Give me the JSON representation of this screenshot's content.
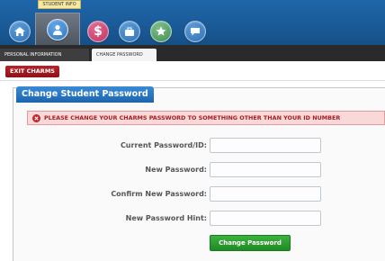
{
  "nav": {
    "tooltip": "STUDENT INFO",
    "icons": [
      {
        "name": "home-icon",
        "color": "#3a84cc"
      },
      {
        "name": "student-info-icon",
        "color": "#2f74bd"
      },
      {
        "name": "billing-icon",
        "color": "#c2456f"
      },
      {
        "name": "briefcase-icon",
        "color": "#3a84cc"
      },
      {
        "name": "star-icon",
        "color": "#5aa36a"
      },
      {
        "name": "chat-icon",
        "color": "#3a84cc"
      }
    ]
  },
  "tabs": {
    "personal": "PERSONAL INFORMATION",
    "change_password": "CHANGE PASSWORD"
  },
  "exit_label": "EXIT CHARMS",
  "panel": {
    "title": "Change Student Password",
    "alert": "PLEASE CHANGE YOUR CHARMS PASSWORD TO SOMETHING OTHER THAN YOUR ID NUMBER"
  },
  "form": {
    "current_label": "Current Password/ID:",
    "new_label": "New Password:",
    "confirm_label": "Confirm New Password:",
    "hint_label": "New Password Hint:",
    "current_value": "",
    "new_value": "",
    "confirm_value": "",
    "hint_value": "",
    "submit_label": "Change Password"
  },
  "colors": {
    "top_bar": "#1b5d9c",
    "exit_button": "#a11c21",
    "alert_bg": "#f8d8d8",
    "submit_button": "#2a9c2e"
  }
}
